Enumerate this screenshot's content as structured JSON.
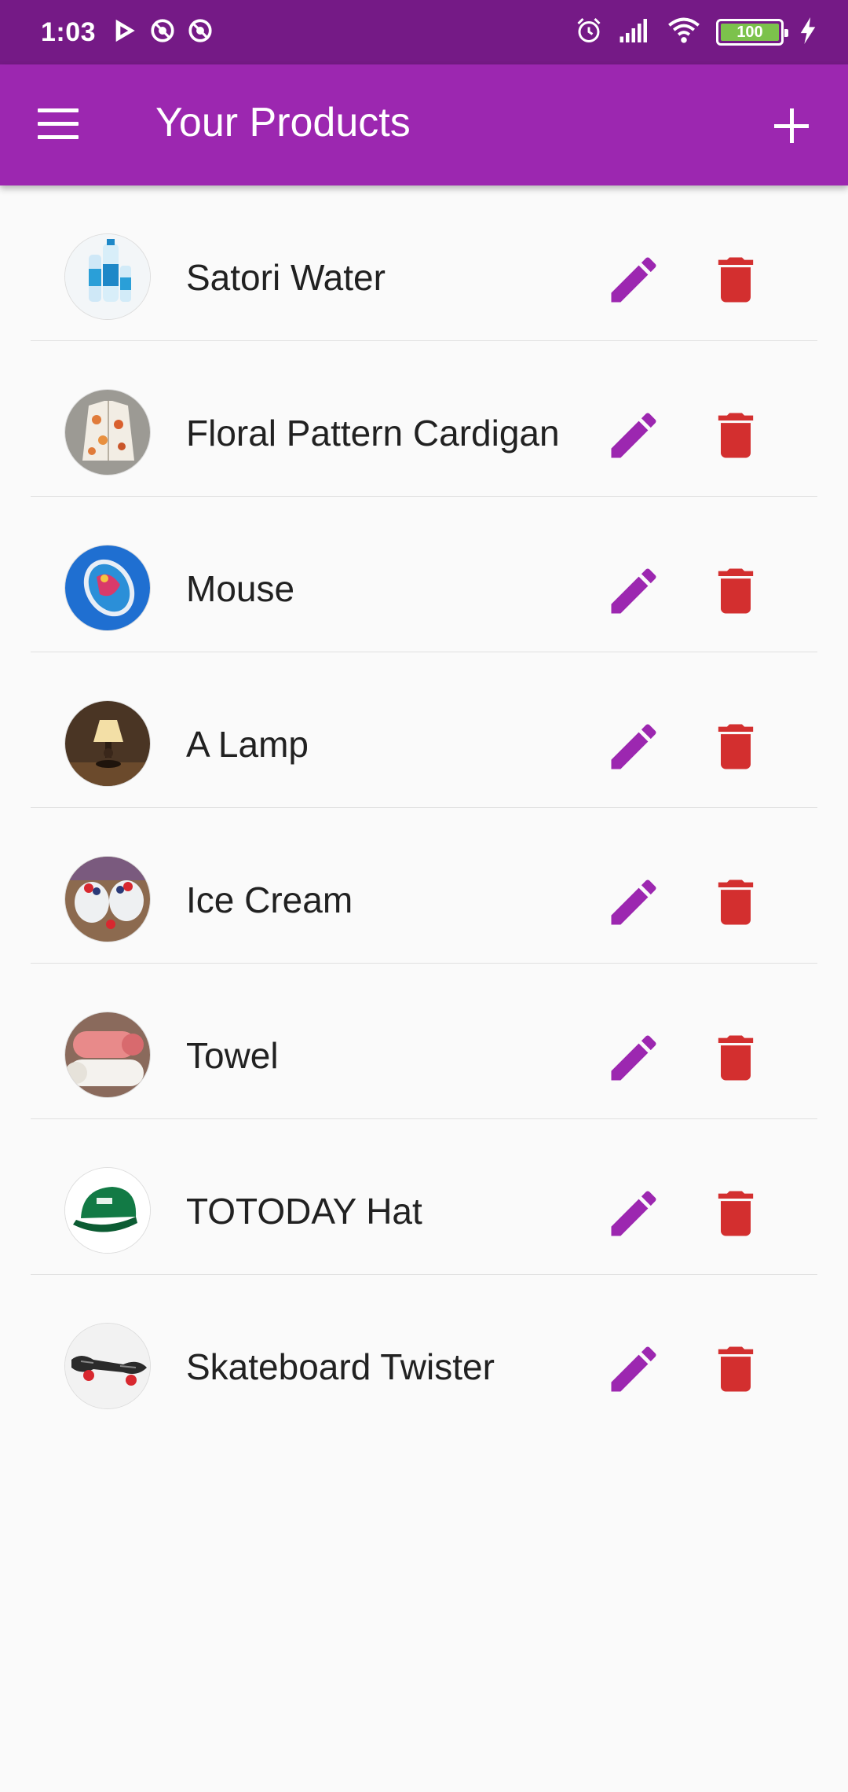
{
  "status_bar": {
    "time": "1:03",
    "battery_level": "100",
    "icons": [
      "play-icon",
      "notification-icon",
      "notification-icon",
      "alarm-icon",
      "signal-icon",
      "wifi-icon",
      "battery-icon",
      "charging-icon"
    ]
  },
  "app_bar": {
    "title": "Your Products",
    "menu_icon": "hamburger-menu-icon",
    "add_icon": "plus-icon"
  },
  "colors": {
    "primary": "#9c27b0",
    "status_bar": "#751a86",
    "delete": "#d32f2f",
    "edit": "#9c27b0"
  },
  "products": [
    {
      "title": "Satori Water",
      "thumbnail": "water-bottles-image"
    },
    {
      "title": "Floral Pattern Cardigan",
      "thumbnail": "cardigan-image"
    },
    {
      "title": "Mouse",
      "thumbnail": "computer-mouse-image"
    },
    {
      "title": "A Lamp",
      "thumbnail": "table-lamp-image"
    },
    {
      "title": "Ice Cream",
      "thumbnail": "ice-cream-image"
    },
    {
      "title": "Towel",
      "thumbnail": "towels-image"
    },
    {
      "title": "TOTODAY Hat",
      "thumbnail": "green-cap-image"
    },
    {
      "title": "Skateboard Twister",
      "thumbnail": "skateboard-image"
    }
  ]
}
